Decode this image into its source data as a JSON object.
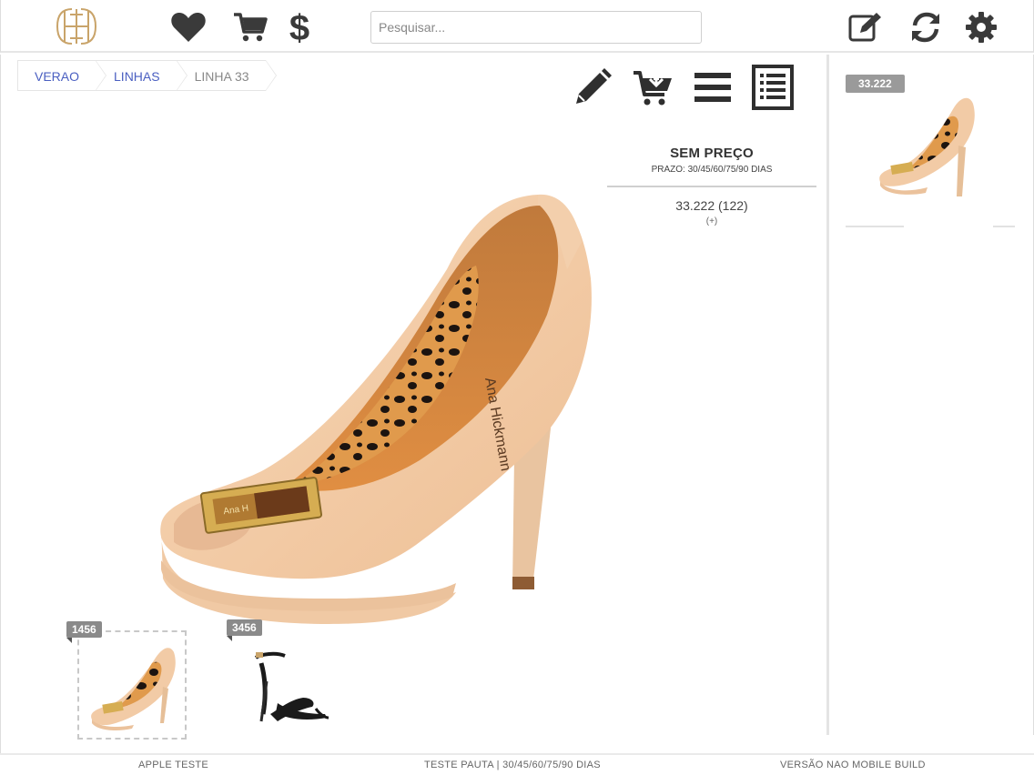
{
  "header": {
    "search_placeholder": "Pesquisar...",
    "icons": [
      "logo-monogram",
      "heart-icon",
      "cart-icon",
      "dollar-icon",
      "edit-note-icon",
      "refresh-icon",
      "gear-icon"
    ]
  },
  "breadcrumb": [
    {
      "label": "VERAO"
    },
    {
      "label": "LINHAS"
    },
    {
      "label": "LINHA 33"
    }
  ],
  "actions": [
    "pencil-icon",
    "cart-download-icon",
    "menu-icon",
    "list-document-icon"
  ],
  "product": {
    "price_label": "SEM PREÇO",
    "prazo": "PRAZO: 30/45/60/75/90 DIAS",
    "reference": "33.222 (122)",
    "more": "(+)",
    "insole_brand": "Ana Hickmann"
  },
  "thumbnails": [
    {
      "badge": "1456",
      "color": "nude"
    },
    {
      "badge": "3456",
      "color": "black"
    }
  ],
  "right_panel": {
    "badge": "33.222"
  },
  "footer": {
    "left": "APPLE TESTE",
    "center": "TESTE PAUTA | 30/45/60/75/90 DIAS",
    "right": "VERSÃO NAO MOBILE BUILD"
  },
  "colors": {
    "link": "#4a5fc1",
    "icon": "#3a3a3a",
    "shoe_nude": "#f2cba6",
    "logo_gold": "#c9a46a"
  }
}
